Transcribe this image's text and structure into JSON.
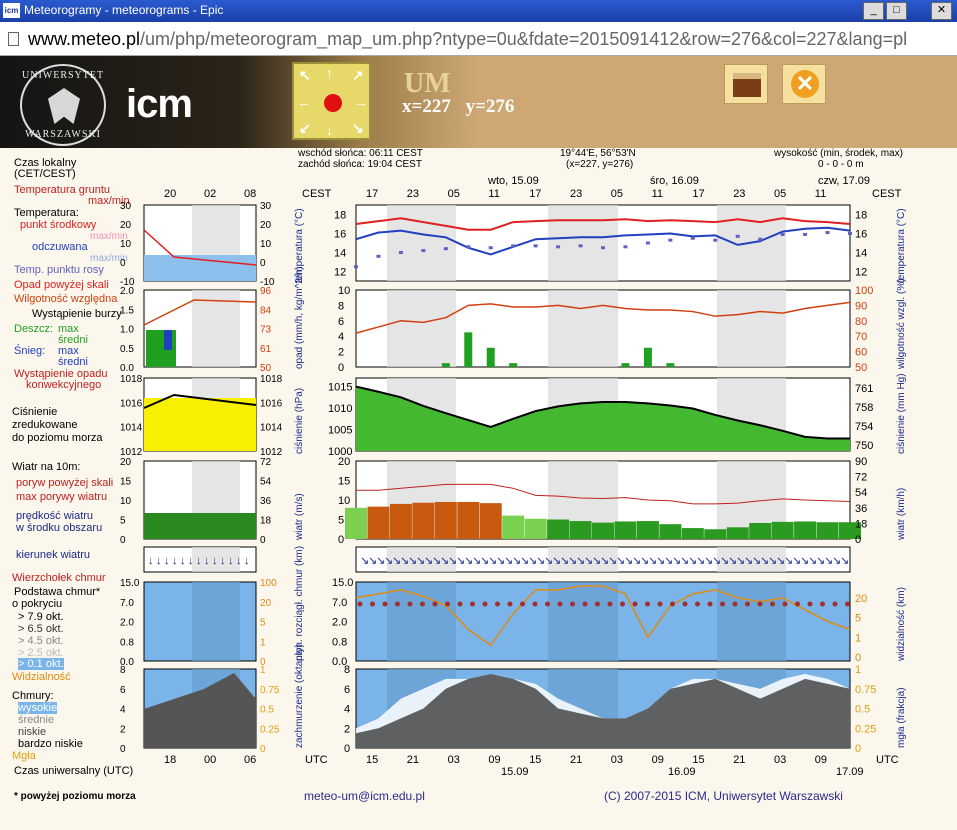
{
  "window": {
    "app_icon": "icm",
    "title": "Meteorogramy - meteorograms - Epic",
    "buttons": [
      "_",
      "□",
      "✕"
    ]
  },
  "address": {
    "host": "www.meteo.pl",
    "path": "/um/php/meteorogram_map_um.php?ntype=0u&fdate=2015091412&row=276&col=227&lang=pl"
  },
  "header": {
    "uw_top": "UNIWERSYTET",
    "uw_bottom": "WARSZAWSKI",
    "icm_logo": "icm",
    "model": "UM",
    "coords": "x=227   y=276",
    "colors": {
      "gold": "#cda874",
      "dark": "#141414"
    }
  },
  "info": {
    "sunrise": "wschód słońca: 06:11 CEST",
    "sunset": "zachód słońca: 19:04 CEST",
    "latlon": "19°44'E, 56°53'N",
    "grid": "(x=227, y=276)",
    "height_title": "wysokość (min, środek, max)",
    "height_vals": "0 - 0 - 0 m"
  },
  "legend": {
    "local_time": "Czas lokalny",
    "local_time2": "(CET/CEST)",
    "ground_temp": "Temperatura gruntu",
    "ground_temp2": "max/min",
    "temperature": "Temperatura:",
    "temp_mid": "punkt środkowy",
    "temp_mid_mm": "max/min",
    "temp_feel": "odczuwana",
    "temp_feel_mm": "max/min",
    "dew": "Temp. punktu rosy",
    "precip_above": "Opad powyżej skali",
    "humidity": "Wilgotność względna",
    "storm": "Wystąpienie burzy",
    "rain": "Deszcz:",
    "rain_max": "max",
    "rain_avg": "średni",
    "snow": "Śnieg:",
    "snow_max": "max",
    "snow_avg": "średni",
    "conv": "Wystąpienie opadu",
    "conv2": "konwekcyjnego",
    "pressure1": "Ciśnienie",
    "pressure2": "zredukowane",
    "pressure3": "do poziomu morza",
    "wind_at": "Wiatr na 10m:",
    "gust_above": "poryw powyżej skali",
    "gust_max": "max porywy wiatru",
    "wind_speed": "prędkość wiatru",
    "wind_speed2": "w środku obszaru",
    "wind_dir": "kierunek wiatru",
    "cloud_top": "Wierzchołek chmur",
    "cloud_base": "Podstawa chmur*",
    "cloud_base2": "o pokryciu",
    "c79": "> 7.9 okt.",
    "c65": "> 6.5 okt.",
    "c45": "> 4.5 okt.",
    "c25": "> 2.5 okt.",
    "c01": "> 0.1 okt.",
    "visibility": "Widzialność",
    "clouds": "Chmury:",
    "cl_high": "wysokie",
    "cl_mid": "średnie",
    "cl_low": "niskie",
    "cl_vlow": "bardzo niskie",
    "fog": "Mgła",
    "utc": "Czas uniwersalny (UTC)",
    "footnote": "* powyżej poziomu morza"
  },
  "axes": {
    "cest": "CEST",
    "utc": "UTC",
    "cest_hours": [
      "17",
      "23",
      "05",
      "11",
      "17",
      "23",
      "05",
      "11",
      "17",
      "23",
      "05",
      "11"
    ],
    "utc_hours": [
      "15",
      "21",
      "03",
      "09",
      "15",
      "21",
      "03",
      "09",
      "15",
      "21",
      "03",
      "09"
    ],
    "days_top": [
      "wto, 15.09",
      "śro, 16.09",
      "czw, 17.09"
    ],
    "days_bottom": [
      "15.09",
      "16.09",
      "17.09"
    ],
    "mini_cest": [
      "20",
      "02",
      "08"
    ],
    "mini_utc": [
      "18",
      "00",
      "06"
    ],
    "left_titles": [
      "temperatura (°C)",
      "opad (mm/h, kg/m^2/h)",
      "ciśnienie (hPa)",
      "wiatr (m/s)",
      "",
      "pion. rozciągł. chmur (km)",
      "zachmurzenie (oktanty)"
    ],
    "right_titles": [
      "temperatura (°C)",
      "wilgotność wzgl. (%)",
      "ciśnienie (mm Hg)",
      "wiatr (km/h)",
      "",
      "widzialność (km)",
      "mgła (frakcja)"
    ],
    "temp_ticks": [
      "18",
      "16",
      "14",
      "12"
    ],
    "precip_ticks": [
      "10",
      "8",
      "6",
      "4",
      "2",
      "0"
    ],
    "hum_ticks": [
      "100",
      "90",
      "80",
      "70",
      "60",
      "50"
    ],
    "press_ticks": [
      "1015",
      "1010",
      "1005",
      "1000"
    ],
    "mmhg_ticks": [
      "761",
      "758",
      "754",
      "750"
    ],
    "wind_ticks": [
      "20",
      "15",
      "10",
      "5",
      "0"
    ],
    "kmh_ticks": [
      "90",
      "72",
      "54",
      "36",
      "18",
      "0"
    ],
    "cloud_ticks": [
      "15.0",
      "7.0",
      "2.0",
      "0.8",
      "0.0"
    ],
    "vis_ticks": [
      "20",
      "5",
      "1",
      "0"
    ],
    "okta_ticks": [
      "8",
      "6",
      "4",
      "2",
      "0"
    ],
    "fog_ticks": [
      "1",
      "0.75",
      "0.5",
      "0.25",
      "0"
    ],
    "mini_temp_l": [
      "30",
      "20",
      "10",
      "0",
      "-10"
    ],
    "mini_temp_r": [
      "30",
      "20",
      "10",
      "0",
      "-10"
    ],
    "mini_prec_l": [
      "2.0",
      "1.5",
      "1.0",
      "0.5",
      "0.0"
    ],
    "mini_prec_r": [
      "96",
      "84",
      "73",
      "61",
      "50"
    ],
    "mini_press": [
      "1018",
      "1016",
      "1014",
      "1012"
    ],
    "mini_wind_l": [
      "20",
      "15",
      "10",
      "5",
      "0"
    ],
    "mini_wind_r": [
      "72",
      "54",
      "36",
      "18",
      "0"
    ],
    "mini_cloud_l": [
      "15.0",
      "7.0",
      "2.0",
      "0.8",
      "0.0"
    ],
    "mini_cloud_r": [
      "100",
      "20",
      "5",
      "1",
      "0"
    ],
    "mini_okta_l": [
      "8",
      "6",
      "4",
      "2",
      "0"
    ],
    "mini_okta_r": [
      "1",
      "0.75",
      "0.5",
      "0.25",
      "0"
    ]
  },
  "footer": {
    "email": "meteo-um@icm.edu.pl",
    "copyright": "(C) 2007-2015 ICM, Uniwersytet Warszawski"
  },
  "chart_data": [
    {
      "type": "line",
      "title": "temperatura",
      "ylabel": "(°C)",
      "ylim": [
        11,
        19
      ],
      "series": [
        {
          "name": "max/min",
          "color": "#e02020",
          "values": [
            17,
            17.3,
            17.6,
            17.2,
            16.8,
            16.4,
            16.4,
            17.2,
            17.3,
            17.4,
            17.4,
            17.4,
            17.5,
            17.3,
            17.4,
            17.3,
            17.2,
            17.5,
            17.2,
            17.6,
            17.3,
            17.2,
            17.0
          ]
        },
        {
          "name": "punkt środkowy",
          "color": "#2040c0",
          "values": [
            15.4,
            16.1,
            16.3,
            15.9,
            15.6,
            14.5,
            13.8,
            14.6,
            15.4,
            15.5,
            15.6,
            15.6,
            15.8,
            15.9,
            16.0,
            15.7,
            15.8,
            14.8,
            15.2,
            16.2,
            16.5,
            16.6,
            16.3
          ]
        },
        {
          "name": "Temp. punktu rosy",
          "color": "#6060c0",
          "values": [
            12.5,
            13.6,
            14.0,
            14.2,
            14.4,
            14.6,
            14.5,
            14.7,
            14.7,
            14.6,
            14.7,
            14.5,
            14.6,
            15.0,
            15.3,
            15.5,
            15.3,
            15.7,
            15.4,
            15.9,
            15.9,
            16.1,
            16.0
          ]
        }
      ]
    },
    {
      "type": "bar",
      "title": "opad",
      "ylim": [
        0,
        10
      ],
      "series": [
        {
          "name": "Deszcz: max",
          "color": "#20a020",
          "values": [
            0,
            0,
            0,
            0,
            0.5,
            4.5,
            2.5,
            0.5,
            0,
            0,
            0,
            0,
            0.5,
            2.5,
            0.5,
            0,
            0,
            0,
            0,
            0,
            0,
            0,
            0
          ]
        },
        {
          "name": "Wilgotność względna",
          "color": "#d04010",
          "values": [
            72,
            76,
            80,
            79,
            82,
            90,
            91,
            89,
            89,
            90,
            88,
            90,
            88,
            87,
            87,
            86,
            83,
            84,
            86,
            85,
            88,
            90,
            92
          ]
        }
      ]
    },
    {
      "type": "area",
      "title": "ciśnienie",
      "ylabel": "(hPa)",
      "ylim": [
        1000,
        1017
      ],
      "series": [
        {
          "name": "ciśnienie",
          "color": "#30a030",
          "values": [
            1015,
            1013.8,
            1012.5,
            1010.5,
            1008.8,
            1007.2,
            1005.6,
            1007.5,
            1009.3,
            1010.4,
            1011.1,
            1011.4,
            1011.4,
            1011.1,
            1010.6,
            1009.9,
            1008.4,
            1007.1,
            1006.0,
            1004.7,
            1003.3,
            1002.9,
            1002.9
          ]
        }
      ]
    },
    {
      "type": "area",
      "title": "wiatr",
      "ylabel": "(m/s)",
      "ylim": [
        0,
        20
      ],
      "series": [
        {
          "name": "prędkość wiatru",
          "color": "#2a8a20",
          "values": [
            8,
            8.3,
            9.0,
            9.3,
            9.5,
            9.5,
            9.2,
            6.0,
            5.2,
            5.0,
            4.6,
            4.2,
            4.5,
            4.6,
            3.8,
            2.8,
            2.5,
            3.0,
            4.1,
            4.4,
            4.5,
            4.3,
            4.3
          ]
        },
        {
          "name": "max porywy wiatru",
          "color": "#c02020",
          "values": [
            12.5,
            12.5,
            13.0,
            13.5,
            14,
            14,
            14,
            13,
            11.2,
            11.0,
            10.5,
            10.4,
            10.6,
            10.0,
            9.8,
            9.0,
            9.0,
            9.2,
            9.8,
            10.3,
            10.0,
            9.8,
            9.6
          ]
        }
      ]
    },
    {
      "type": "line",
      "title": "pion. rozciągł. chmur",
      "ylabel": "(km)",
      "series": [
        {
          "name": "Widzialność",
          "color": "#e08a10",
          "values": [
            8,
            8.5,
            9,
            8.2,
            7,
            4,
            2,
            6,
            9,
            9,
            9.5,
            9.5,
            8.5,
            3,
            7,
            8.5,
            9,
            8,
            7.5,
            8,
            6.5,
            5,
            4
          ]
        }
      ]
    },
    {
      "type": "area",
      "title": "zachmurzenie",
      "ylabel": "(oktanty)",
      "ylim": [
        0,
        8
      ],
      "series": [
        {
          "name": "wysokie",
          "color": "#ffffff",
          "values": [
            2,
            3,
            5,
            6,
            7,
            7,
            7.5,
            7,
            6.5,
            5,
            4,
            3,
            3,
            4,
            6,
            7,
            7,
            6.5,
            6,
            7,
            7.5,
            7,
            6
          ]
        },
        {
          "name": "niskie",
          "color": "#505050",
          "values": [
            1.5,
            2,
            3,
            4,
            6,
            7,
            7.5,
            7,
            6,
            4,
            3.5,
            3,
            3,
            4,
            6,
            6.5,
            7,
            6,
            5,
            6,
            7,
            6.5,
            6
          ]
        }
      ]
    }
  ]
}
